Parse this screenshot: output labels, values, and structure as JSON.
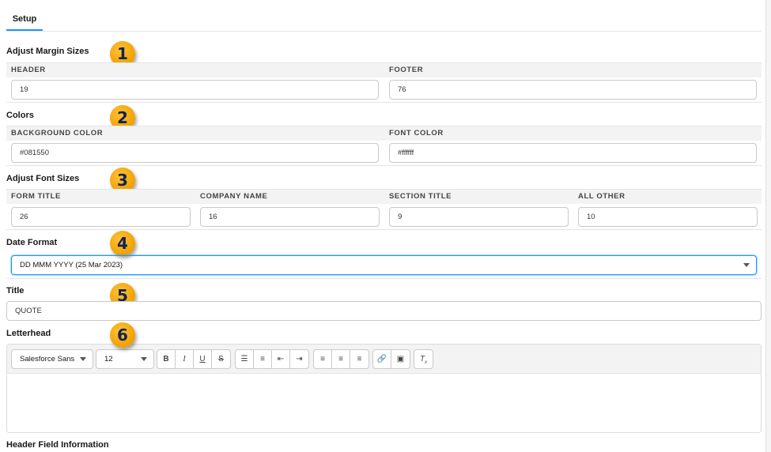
{
  "tabs": [
    {
      "label": "Setup",
      "active": true
    }
  ],
  "sections": {
    "margins": {
      "title": "Adjust Margin Sizes",
      "badge": "1",
      "fields": [
        {
          "label": "HEADER",
          "value": "19"
        },
        {
          "label": "FOOTER",
          "value": "76"
        }
      ]
    },
    "colors": {
      "title": "Colors",
      "badge": "2",
      "fields": [
        {
          "label": "BACKGROUND COLOR",
          "value": "#081550"
        },
        {
          "label": "FONT COLOR",
          "value": "#ffffff"
        }
      ]
    },
    "fonts": {
      "title": "Adjust Font Sizes",
      "badge": "3",
      "fields": [
        {
          "label": "FORM TITLE",
          "value": "26"
        },
        {
          "label": "COMPANY NAME",
          "value": "16"
        },
        {
          "label": "SECTION TITLE",
          "value": "9"
        },
        {
          "label": "ALL OTHER",
          "value": "10"
        }
      ]
    },
    "date": {
      "title": "Date Format",
      "badge": "4",
      "selected": "DD MMM YYYY (25 Mar 2023)"
    },
    "title": {
      "title": "Title",
      "badge": "5",
      "value": "QUOTE"
    },
    "letterhead": {
      "title": "Letterhead",
      "badge": "6",
      "font": "Salesforce Sans",
      "size": "12"
    },
    "next": {
      "title": "Header Field Information"
    }
  },
  "colors": {
    "accent": "#1b96ff",
    "badge": "#f5a500",
    "badge_text": "#14244e"
  }
}
